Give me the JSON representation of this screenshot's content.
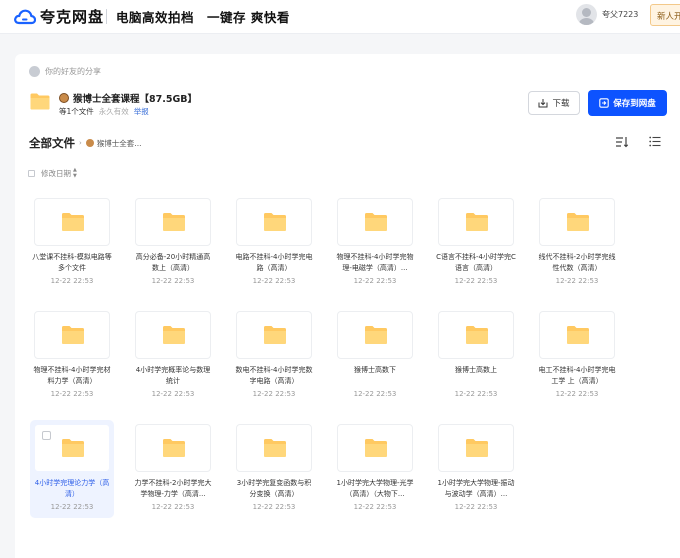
{
  "header": {
    "logo_text": "夸克网盘",
    "slogan": "电脑高效拍档　一键存 爽快看",
    "username": "夸父7223",
    "new_button": "新人开"
  },
  "share": {
    "from_label": "你的好友的分享",
    "title": "猴博士全套课程【87.5GB】",
    "file_count": "等1个文件",
    "validity": "永久有效",
    "report": "举报",
    "download_label": "下载",
    "save_label": "保存到网盘"
  },
  "browser": {
    "title": "全部文件",
    "crumb": "猴博士全套...",
    "sort_label": "修改日期"
  },
  "files": [
    {
      "name": "八堂课不挂科-模拟电路等多个文件",
      "date": "12-22 22:53"
    },
    {
      "name": "高分必备-20小时精通高数上（高清）",
      "date": "12-22 22:53"
    },
    {
      "name": "电路不挂科-4小时学完电路（高清）",
      "date": "12-22 22:53"
    },
    {
      "name": "物理不挂科-4小时学完物理-电磁学（高清）...",
      "date": "12-22 22:53"
    },
    {
      "name": "C语言不挂科-4小时学完C语言（高清）",
      "date": "12-22 22:53"
    },
    {
      "name": "线代不挂科-2小时学完线性代数（高清）",
      "date": "12-22 22:53"
    },
    {
      "name": "物理不挂科-4小时学完材料力学（高清）",
      "date": "12-22 22:53"
    },
    {
      "name": "4小时学完概率论与数理统计",
      "date": "12-22 22:53"
    },
    {
      "name": "数电不挂科-4小时学完数字电路（高清）",
      "date": "12-22 22:53"
    },
    {
      "name": "猴博士高数下",
      "date": "12-22 22:53"
    },
    {
      "name": "猴博士高数上",
      "date": "12-22 22:53"
    },
    {
      "name": "电工不挂科-4小时学完电工学 上（高清）",
      "date": "12-22 22:53"
    },
    {
      "name": "4小时学完理论力学（高清）",
      "date": "12-22 22:53",
      "selected": true
    },
    {
      "name": "力学不挂科-2小时学完大学物理-力学（高清...",
      "date": "12-22 22:53"
    },
    {
      "name": "3小时学完复变函数与积分变换（高清）",
      "date": "12-22 22:53"
    },
    {
      "name": "1小时学完大学物理-光学（高清）（大物下...",
      "date": "12-22 22:53"
    },
    {
      "name": "1小时学完大学物理-振动与波动学（高清）...",
      "date": "12-22 22:53"
    }
  ]
}
